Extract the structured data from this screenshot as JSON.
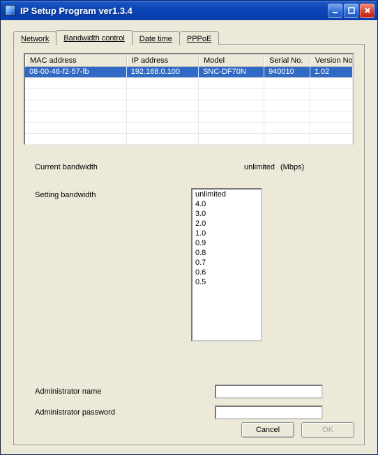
{
  "window": {
    "title": "IP Setup Program ver1.3.4"
  },
  "tabs": {
    "network": "Network",
    "bandwidth": "Bandwidth control",
    "datetime": "Date time",
    "pppoe": "PPPoE"
  },
  "table": {
    "headers": {
      "mac": "MAC address",
      "ip": "IP address",
      "model": "Model",
      "serial": "Serial No.",
      "version": "Version No."
    },
    "rows": [
      {
        "mac": "08-00-46-f2-57-fb",
        "ip": "192.168.0.100",
        "model": "SNC-DF70N",
        "serial": "940010",
        "version": "1.02"
      }
    ]
  },
  "labels": {
    "current_bandwidth": "Current bandwidth",
    "current_value": "unlimited",
    "current_unit": "(Mbps)",
    "setting_bandwidth": "Setting bandwidth",
    "admin_name": "Administrator name",
    "admin_pw": "Administrator password"
  },
  "listbox": {
    "options": [
      "unlimited",
      "4.0",
      "3.0",
      "2.0",
      "1.0",
      "0.9",
      "0.8",
      "0.7",
      "0.6",
      "0.5"
    ]
  },
  "inputs": {
    "admin_name": "",
    "admin_pw": ""
  },
  "buttons": {
    "cancel": "Cancel",
    "ok": "OK"
  }
}
